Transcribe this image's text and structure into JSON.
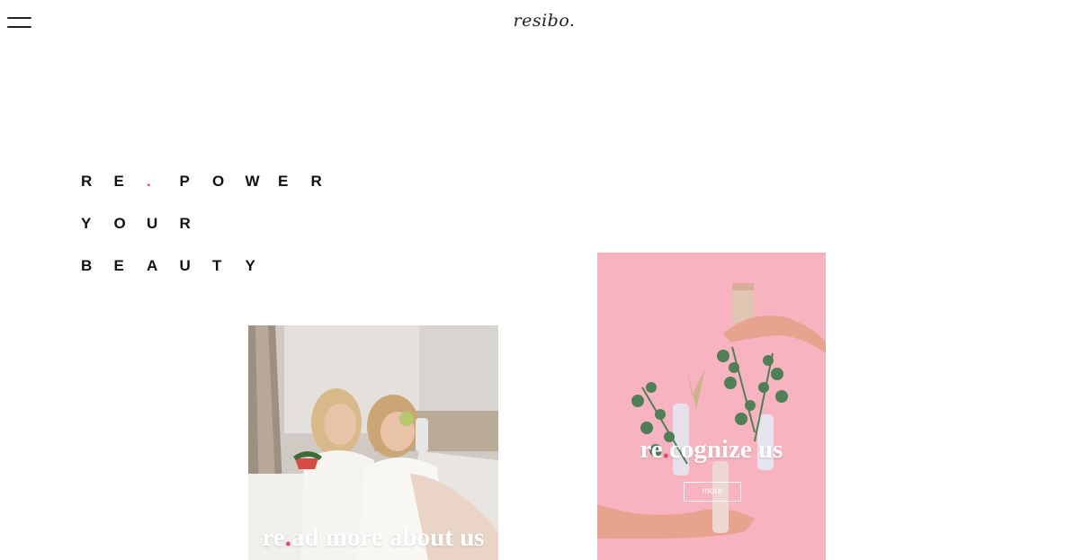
{
  "header": {
    "logo_text": "resibo."
  },
  "hero": {
    "lines": [
      [
        "R",
        "E",
        ".",
        "P",
        "O",
        "W",
        "E",
        "R"
      ],
      [
        "Y",
        "O",
        "U",
        "R"
      ],
      [
        "B",
        "E",
        "A",
        "U",
        "T",
        "Y"
      ]
    ],
    "accent_color": "#e0457b"
  },
  "cards": [
    {
      "title_prefix": "re",
      "title_dot": ".",
      "title_suffix": "ad more about us"
    },
    {
      "title_prefix": "re",
      "title_dot": ".",
      "title_suffix": "cognize us",
      "button_label": "more"
    }
  ],
  "icons": {
    "menu": "hamburger-menu-icon"
  }
}
